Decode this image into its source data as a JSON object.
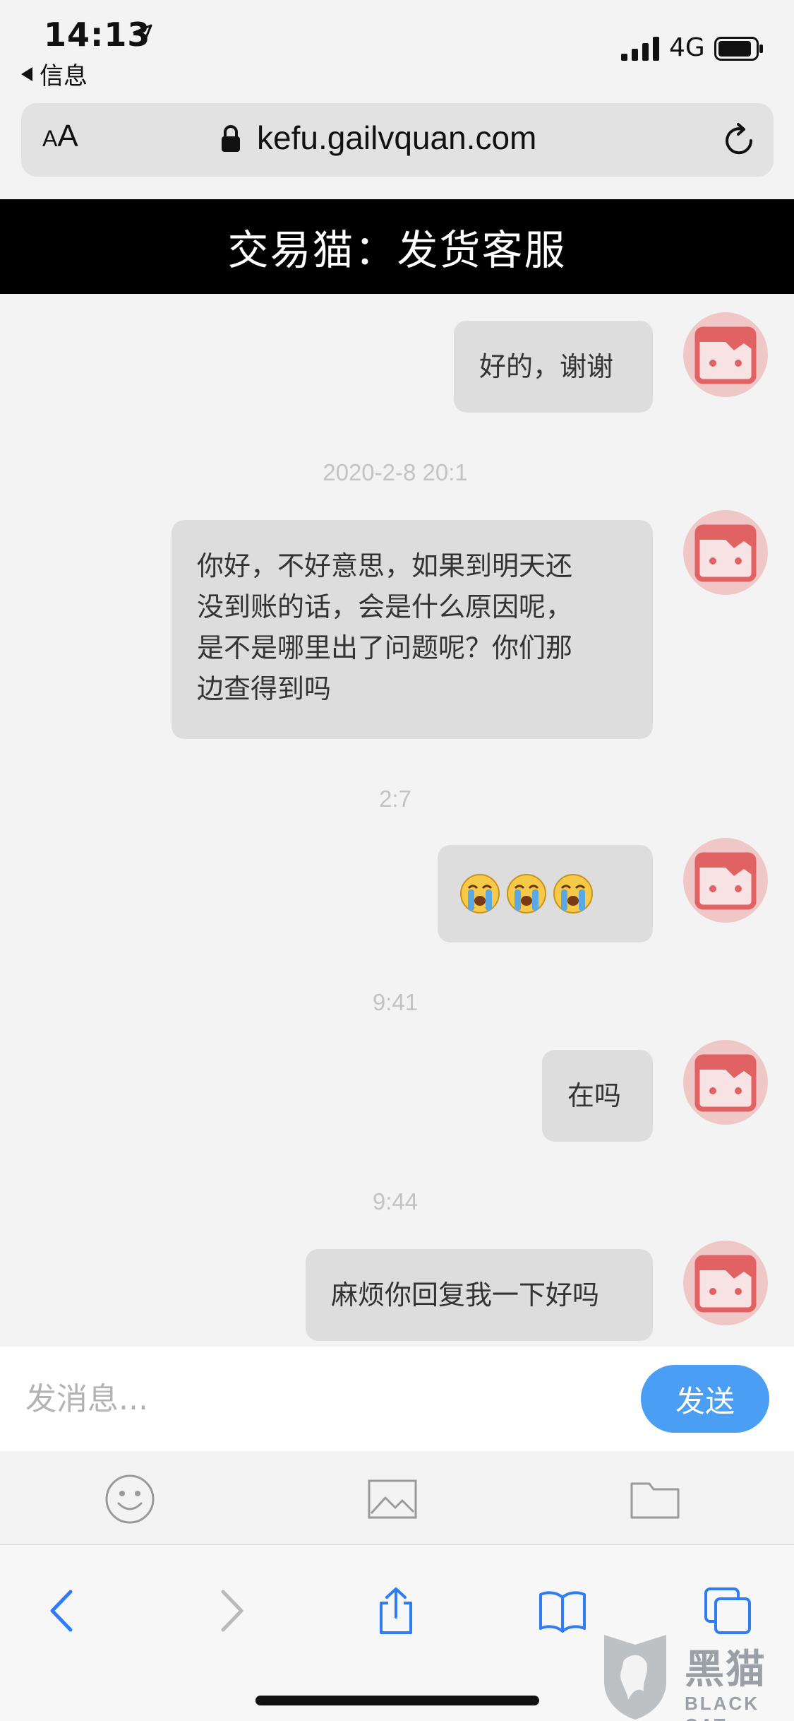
{
  "status_bar": {
    "time": "14:13",
    "back_app": "信息",
    "network": "4G"
  },
  "browser": {
    "text_size_label_small": "A",
    "text_size_label_big": "A",
    "url": "kefu.gailvquan.com"
  },
  "page": {
    "title": "交易猫：发货客服"
  },
  "chat": {
    "messages": [
      {
        "type": "bubble",
        "text": "好的，谢谢"
      },
      {
        "type": "timestamp",
        "text": "2020-2-8 20:1"
      },
      {
        "type": "bubble",
        "lines": [
          "你好，不好意思，如果到明天还",
          "没到账的话，会是什么原因呢，",
          "是不是哪里出了问题呢？你们那",
          "边查得到吗"
        ]
      },
      {
        "type": "timestamp",
        "text": "2:7"
      },
      {
        "type": "bubble",
        "emoji": [
          "crying-face",
          "crying-face",
          "crying-face"
        ]
      },
      {
        "type": "timestamp",
        "text": "9:41"
      },
      {
        "type": "bubble",
        "text": "在吗"
      },
      {
        "type": "timestamp",
        "text": "9:44"
      },
      {
        "type": "bubble",
        "text": "麻烦你回复我一下好吗"
      }
    ]
  },
  "composer": {
    "placeholder": "发消息...",
    "send_label": "发送"
  },
  "toolbar_icons": [
    "smiley-icon",
    "image-icon",
    "folder-icon"
  ],
  "safari_nav_icons": [
    "back-icon",
    "forward-icon",
    "share-icon",
    "bookmarks-icon",
    "tabs-icon"
  ],
  "watermark": {
    "text": "黑猫",
    "subtext": "BLACK CAT"
  },
  "colors": {
    "accent": "#4a9ff5",
    "header_bg": "#000000",
    "bubble_bg": "#dddddd",
    "avatar_red": "#e06262"
  }
}
